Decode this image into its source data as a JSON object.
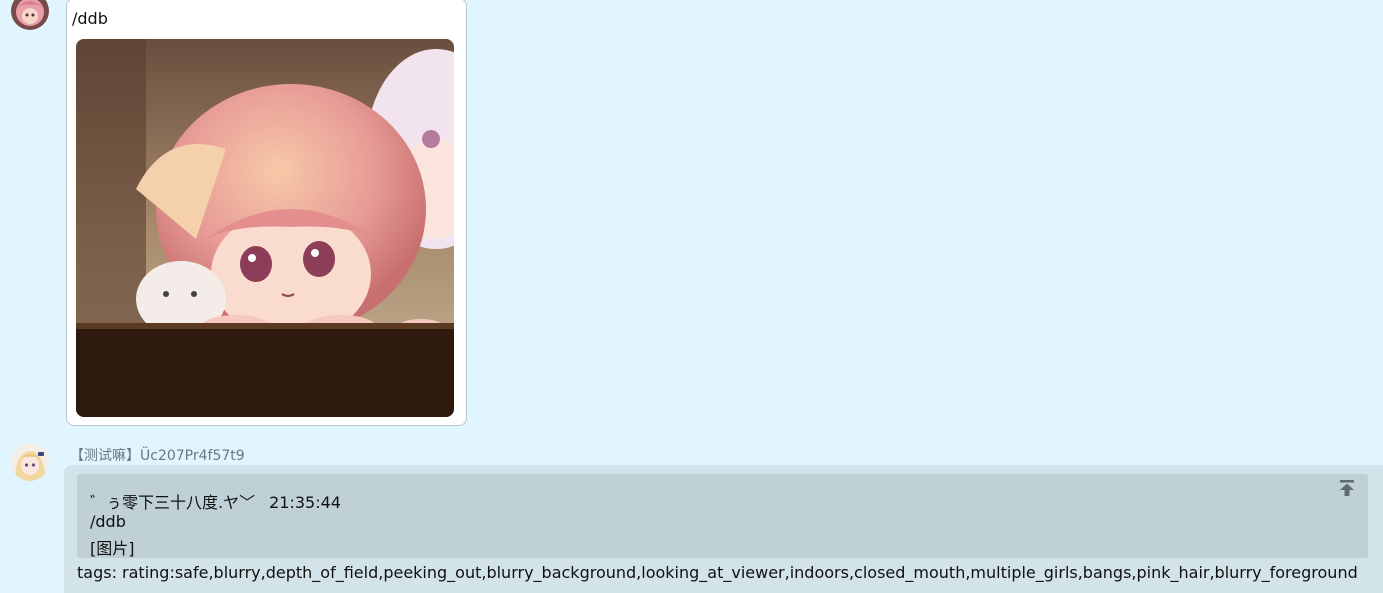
{
  "messages": [
    {
      "avatar": "user-avatar-pink-hair",
      "text": "/ddb",
      "image": {
        "description_icon": "anime-illustration-image"
      }
    },
    {
      "sender": "【测试嘛】Üc207Pr4f57t9",
      "avatar": "bot-avatar-blonde-girl",
      "quote": {
        "author": "゛ぅ零下三十八度.ヤ﹀",
        "time": "21:35:44",
        "line2": "/ddb",
        "line3": "[图片]",
        "pin_icon": "pin-to-top-icon"
      },
      "tags": "tags: rating:safe,blurry,depth_of_field,peeking_out,blurry_background,looking_at_viewer,indoors,closed_mouth,multiple_girls,bangs,pink_hair,blurry_foreground"
    }
  ],
  "colors": {
    "background": "#e0f5fd",
    "bubble_user": "#ffffff",
    "bubble_bot": "#d2e3e9",
    "quote_bg": "#bfd0d7"
  }
}
